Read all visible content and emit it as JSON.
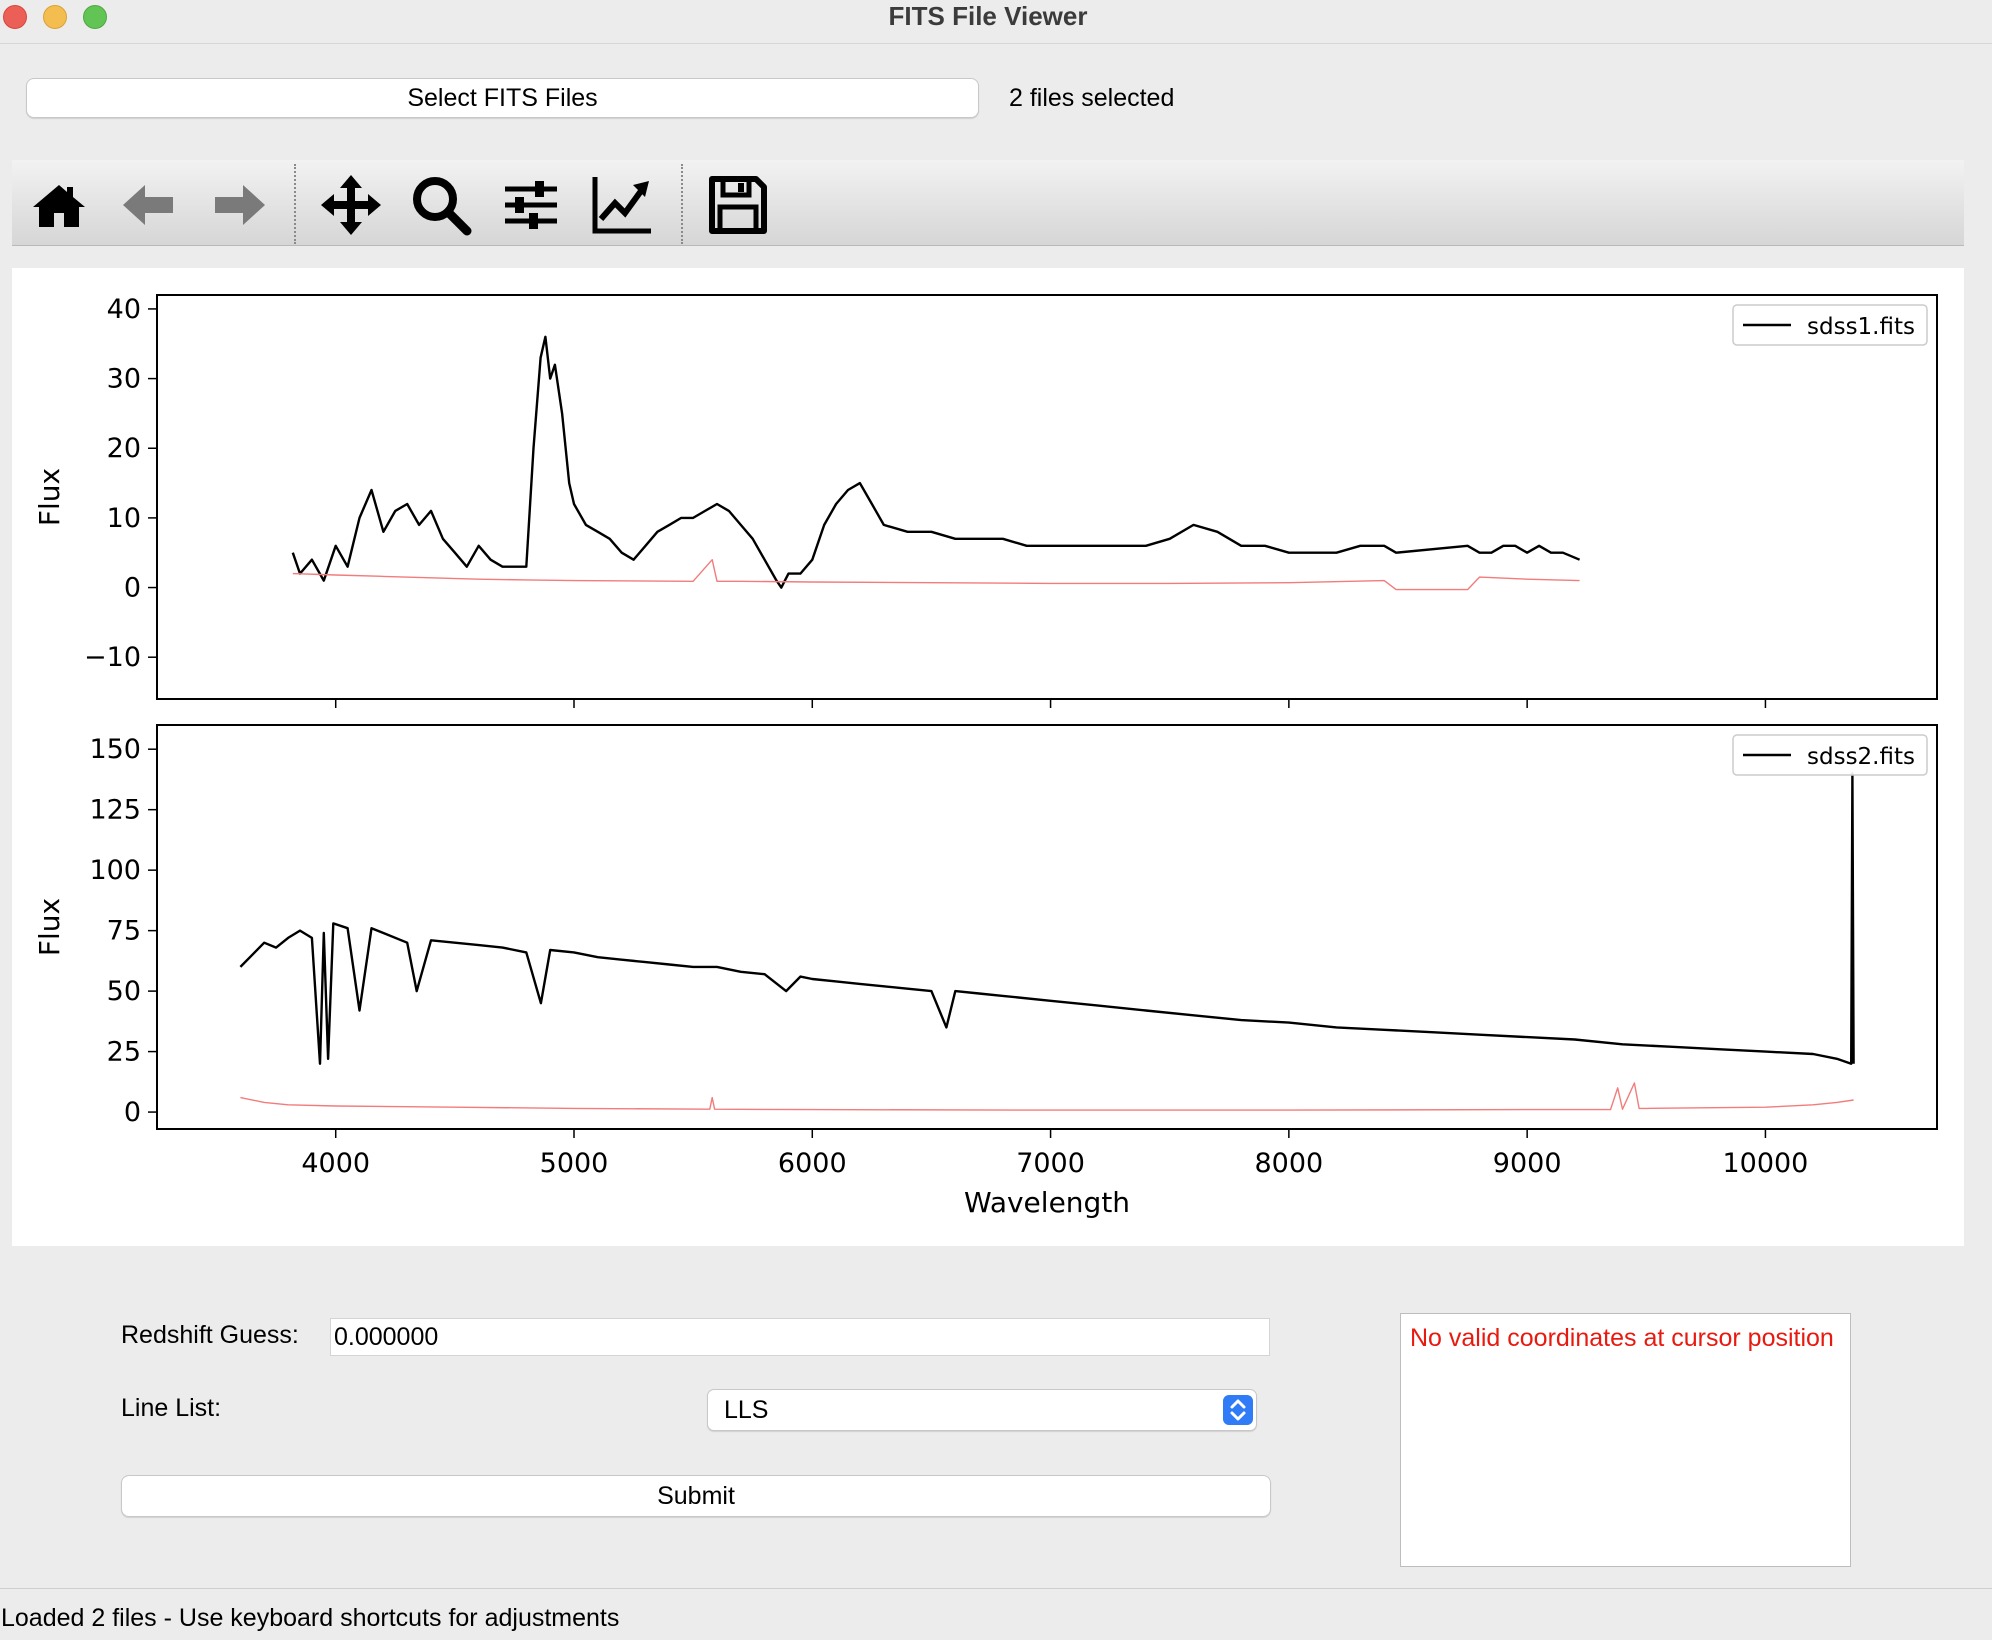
{
  "window": {
    "title": "FITS File Viewer"
  },
  "file_select": {
    "button_label": "Select FITS Files",
    "status": "2 files selected"
  },
  "toolbar": {
    "tools": [
      "home-icon",
      "back-arrow-icon",
      "forward-arrow-icon",
      "pan-icon",
      "zoom-icon",
      "subplots-icon",
      "edit-axis-icon",
      "save-icon"
    ]
  },
  "chart_data": [
    {
      "type": "line",
      "legend": "sdss1.fits",
      "legend_position": "top-right",
      "xlabel": "",
      "ylabel": "Flux",
      "xlim": [
        3250,
        10720
      ],
      "ylim": [
        -16,
        42
      ],
      "yticks": [
        -10,
        0,
        10,
        20,
        30,
        40
      ],
      "ytick_labels": [
        "−10",
        "0",
        "10",
        "20",
        "30",
        "40"
      ],
      "series": [
        {
          "name": "sdss1.fits",
          "color": "#000000",
          "x": [
            3820,
            3850,
            3900,
            3950,
            4000,
            4050,
            4100,
            4150,
            4200,
            4250,
            4300,
            4350,
            4400,
            4450,
            4500,
            4550,
            4600,
            4650,
            4700,
            4750,
            4800,
            4830,
            4860,
            4880,
            4900,
            4920,
            4950,
            4980,
            5000,
            5050,
            5100,
            5150,
            5200,
            5250,
            5300,
            5350,
            5400,
            5450,
            5500,
            5550,
            5600,
            5650,
            5700,
            5750,
            5800,
            5850,
            5870,
            5900,
            5950,
            6000,
            6050,
            6100,
            6150,
            6200,
            6250,
            6300,
            6400,
            6500,
            6600,
            6700,
            6800,
            6900,
            7000,
            7100,
            7200,
            7300,
            7400,
            7500,
            7600,
            7700,
            7800,
            7900,
            8000,
            8100,
            8200,
            8300,
            8350,
            8400,
            8450,
            8750,
            8800,
            8850,
            8900,
            8950,
            9000,
            9050,
            9100,
            9150,
            9220
          ],
          "y": [
            5,
            2,
            4,
            1,
            6,
            3,
            10,
            14,
            8,
            11,
            12,
            9,
            11,
            7,
            5,
            3,
            6,
            4,
            3,
            3,
            3,
            20,
            33,
            36,
            30,
            32,
            25,
            15,
            12,
            9,
            8,
            7,
            5,
            4,
            6,
            8,
            9,
            10,
            10,
            11,
            12,
            11,
            9,
            7,
            4,
            1,
            0,
            2,
            2,
            4,
            9,
            12,
            14,
            15,
            12,
            9,
            8,
            8,
            7,
            7,
            7,
            6,
            6,
            6,
            6,
            6,
            6,
            7,
            9,
            8,
            6,
            6,
            5,
            5,
            5,
            6,
            6,
            6,
            5,
            6,
            5,
            5,
            6,
            6,
            5,
            6,
            5,
            5,
            4
          ]
        },
        {
          "name": "",
          "color": "#f27c7c",
          "x": [
            3820,
            4000,
            4200,
            4400,
            4600,
            4800,
            5000,
            5500,
            5580,
            5600,
            5700,
            6000,
            6500,
            7000,
            7500,
            8000,
            8400,
            8450,
            8750,
            8800,
            9000,
            9220
          ],
          "y": [
            2,
            1.8,
            1.6,
            1.4,
            1.2,
            1.1,
            1.0,
            0.9,
            4,
            0.9,
            0.9,
            0.8,
            0.7,
            0.6,
            0.6,
            0.7,
            1.0,
            -0.3,
            -0.3,
            1.5,
            1.2,
            1.0
          ]
        }
      ]
    },
    {
      "type": "line",
      "legend": "sdss2.fits",
      "legend_position": "top-right",
      "xlabel": "Wavelength",
      "ylabel": "Flux",
      "xlim": [
        3250,
        10720
      ],
      "ylim": [
        -7,
        160
      ],
      "yticks": [
        0,
        25,
        50,
        75,
        100,
        125,
        150
      ],
      "ytick_labels": [
        "0",
        "25",
        "50",
        "75",
        "100",
        "125",
        "150"
      ],
      "xticks": [
        4000,
        5000,
        6000,
        7000,
        8000,
        9000,
        10000
      ],
      "xtick_labels": [
        "4000",
        "5000",
        "6000",
        "7000",
        "8000",
        "9000",
        "10000"
      ],
      "series": [
        {
          "name": "sdss2.fits",
          "color": "#000000",
          "x": [
            3600,
            3650,
            3700,
            3750,
            3800,
            3850,
            3900,
            3934,
            3950,
            3968,
            3990,
            4050,
            4100,
            4150,
            4200,
            4300,
            4340,
            4400,
            4500,
            4600,
            4700,
            4800,
            4861,
            4900,
            5000,
            5100,
            5200,
            5300,
            5400,
            5500,
            5600,
            5700,
            5800,
            5890,
            5950,
            6000,
            6100,
            6200,
            6300,
            6400,
            6500,
            6563,
            6600,
            6700,
            6800,
            7000,
            7200,
            7400,
            7600,
            7800,
            8000,
            8200,
            8400,
            8600,
            8800,
            9000,
            9200,
            9400,
            9600,
            9800,
            10000,
            10200,
            10300,
            10360,
            10365,
            10370
          ],
          "y": [
            60,
            65,
            70,
            68,
            72,
            75,
            72,
            20,
            74,
            22,
            78,
            76,
            42,
            76,
            74,
            70,
            50,
            71,
            70,
            69,
            68,
            66,
            45,
            67,
            66,
            64,
            63,
            62,
            61,
            60,
            60,
            58,
            57,
            50,
            56,
            55,
            54,
            53,
            52,
            51,
            50,
            35,
            50,
            49,
            48,
            46,
            44,
            42,
            40,
            38,
            37,
            35,
            34,
            33,
            32,
            31,
            30,
            28,
            27,
            26,
            25,
            24,
            22,
            20,
            140,
            20
          ]
        },
        {
          "name": "",
          "color": "#f27c7c",
          "x": [
            3600,
            3700,
            3800,
            4000,
            4500,
            5000,
            5570,
            5580,
            5590,
            6000,
            7000,
            8000,
            9000,
            9350,
            9380,
            9400,
            9450,
            9470,
            9500,
            10000,
            10200,
            10300,
            10370
          ],
          "y": [
            6,
            4,
            3,
            2.5,
            2,
            1.5,
            1.2,
            6,
            1.2,
            1.0,
            0.8,
            0.8,
            1.0,
            1.0,
            10,
            1.2,
            12,
            1.5,
            1.5,
            2,
            3,
            4,
            5
          ]
        }
      ]
    }
  ],
  "form": {
    "redshift_label": "Redshift Guess:",
    "redshift_value": "0.000000",
    "linelist_label": "Line List:",
    "linelist_value": "LLS",
    "submit_label": "Submit"
  },
  "coords": {
    "message": "No valid coordinates at cursor position"
  },
  "status_bar": {
    "text": "Loaded 2 files - Use keyboard shortcuts for adjustments"
  }
}
